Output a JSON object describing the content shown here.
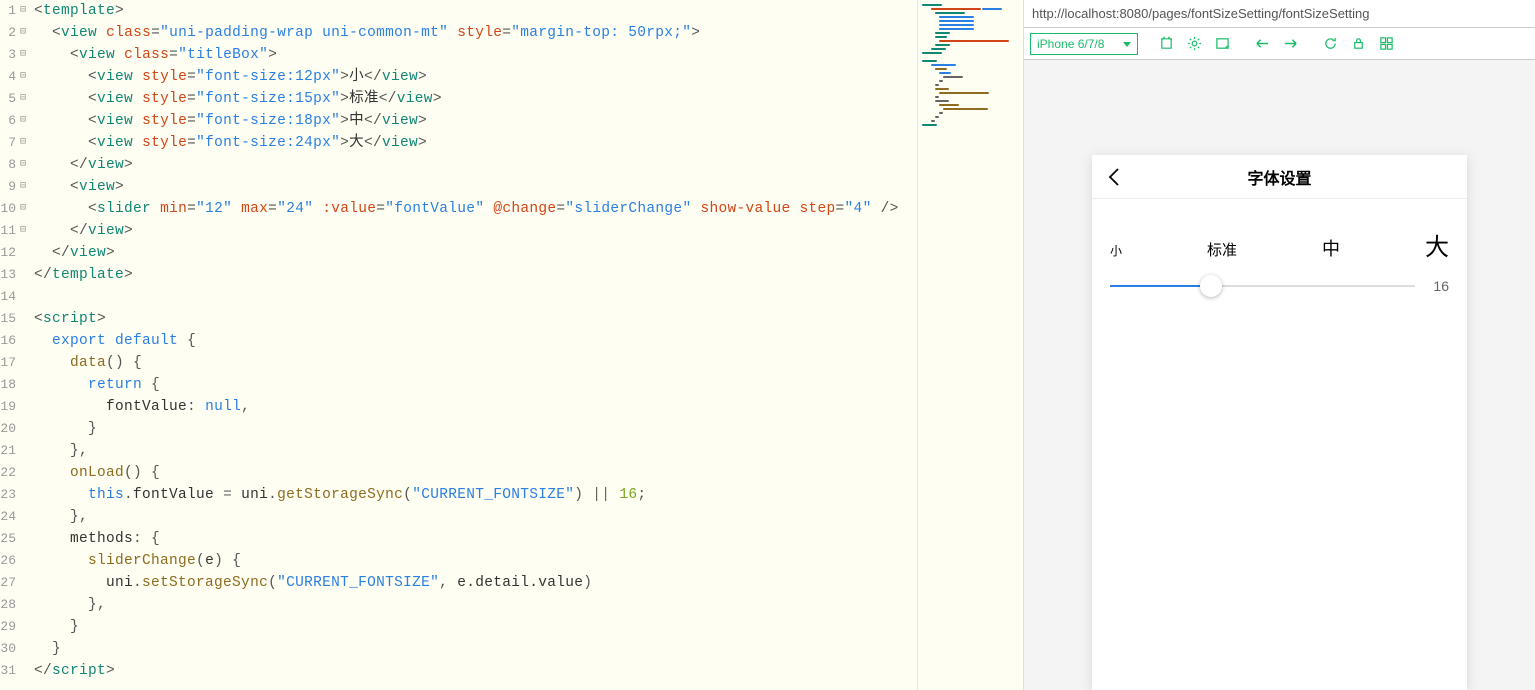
{
  "editor": {
    "lines": [
      1,
      2,
      3,
      4,
      5,
      6,
      7,
      8,
      9,
      10,
      11,
      12,
      13,
      14,
      15,
      16,
      17,
      18,
      19,
      20,
      21,
      22,
      23,
      24,
      25,
      26,
      27,
      28,
      29,
      30,
      31
    ],
    "fold_open": "⊟",
    "fold_none": " "
  },
  "code": {
    "template_open": "template",
    "view": "view",
    "slider": "slider",
    "script": "script",
    "class_attr": "class",
    "style_attr": "style",
    "min_attr": "min",
    "max_attr": "max",
    "value_attr": ":value",
    "change_attr": "@change",
    "showvalue_attr": "show-value",
    "step_attr": "step",
    "wrap_class": "uni-padding-wrap uni-common-mt",
    "wrap_style": "margin-top: 50rpx;",
    "titlebox_class": "titleBox",
    "fs12": "font-size:12px",
    "fs15": "font-size:15px",
    "fs18": "font-size:18px",
    "fs24": "font-size:24px",
    "txt_small": "小",
    "txt_std": "标准",
    "txt_mid": "中",
    "txt_big": "大",
    "min_val": "12",
    "max_val": "24",
    "font_value": "fontValue",
    "slider_change": "sliderChange",
    "step_val": "4",
    "export": "export",
    "default": "default",
    "data_fn": "data",
    "return": "return",
    "fontvalue_key": "fontValue",
    "null": "null",
    "onload": "onLoad",
    "this": "this",
    "uni": "uni",
    "getstorage": "getStorageSync",
    "setstorage": "setStorageSync",
    "current_fontsize": "CURRENT_FONTSIZE",
    "fallback": "16",
    "methods": "methods",
    "sliderchange_fn": "sliderChange",
    "e_param": "e",
    "detail_value": "e.detail.value"
  },
  "preview": {
    "url": "http://localhost:8080/pages/fontSizeSetting/fontSizeSetting",
    "device": "iPhone 6/7/8",
    "page_title": "字体设置",
    "label_small": "小",
    "label_std": "标准",
    "label_mid": "中",
    "label_big": "大",
    "slider_value": "16"
  }
}
